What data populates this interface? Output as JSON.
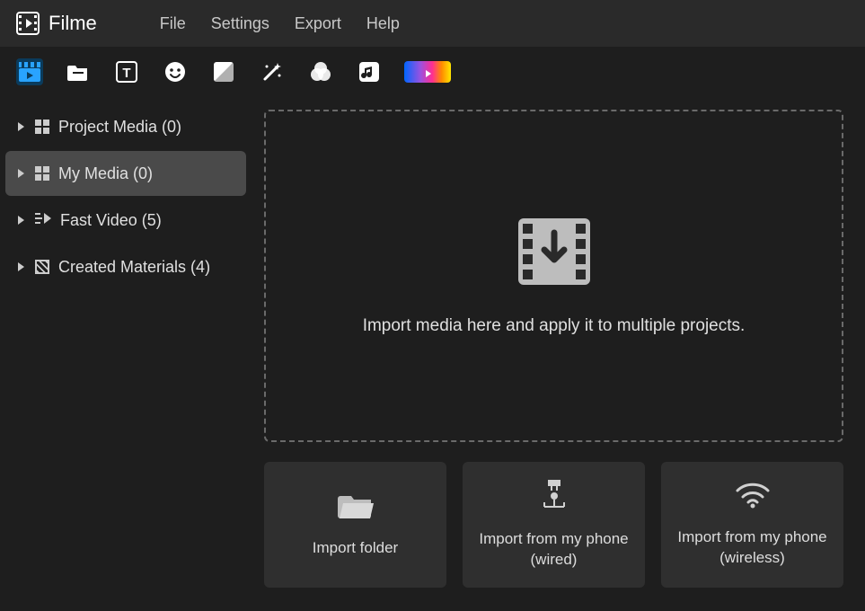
{
  "app": {
    "name": "Filme"
  },
  "menu": {
    "file": "File",
    "settings": "Settings",
    "export": "Export",
    "help": "Help"
  },
  "toolbar": {
    "media": "media-tab",
    "folder": "folder-tab",
    "text": "text-tab",
    "sticker": "sticker-tab",
    "transition": "transition-tab",
    "effects": "effects-tab",
    "filters": "filters-tab",
    "audio": "audio-tab",
    "color": "color-tab"
  },
  "sidebar": {
    "items": [
      {
        "label": "Project Media (0)",
        "icon": "grid"
      },
      {
        "label": "My Media (0)",
        "icon": "grid",
        "active": true
      },
      {
        "label": "Fast Video (5)",
        "icon": "arrows"
      },
      {
        "label": "Created Materials (4)",
        "icon": "hatch"
      }
    ]
  },
  "dropzone": {
    "hint": "Import media here and apply it to multiple projects."
  },
  "import_buttons": {
    "folder": "Import folder",
    "phone_wired": "Import from my phone (wired)",
    "phone_wireless": "Import from my phone (wireless)"
  }
}
